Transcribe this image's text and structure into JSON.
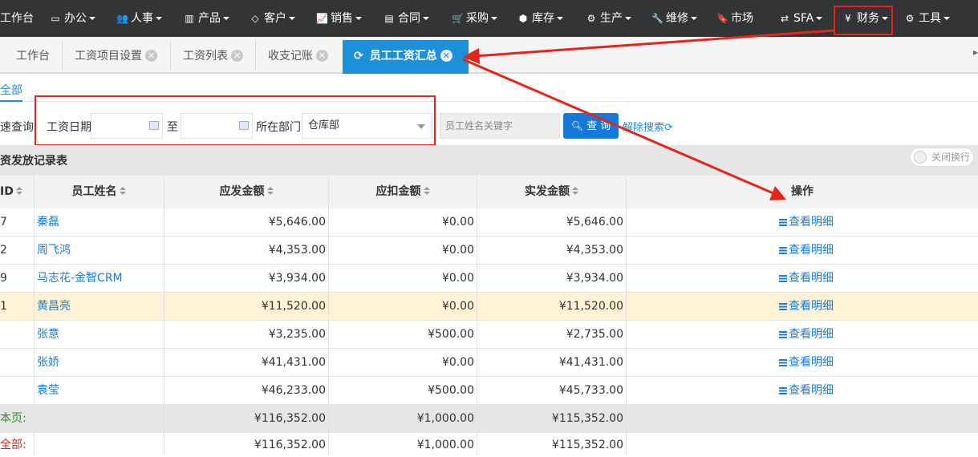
{
  "nav": {
    "items": [
      {
        "label": "工作台",
        "icon": "home-icon",
        "caret": false
      },
      {
        "label": "办公",
        "icon": "monitor-icon",
        "caret": true
      },
      {
        "label": "人事",
        "icon": "users-icon",
        "caret": true
      },
      {
        "label": "产品",
        "icon": "barcode-icon",
        "caret": true
      },
      {
        "label": "客户",
        "icon": "diamond-icon",
        "caret": true
      },
      {
        "label": "销售",
        "icon": "line-chart-icon",
        "caret": true
      },
      {
        "label": "合同",
        "icon": "newspaper-icon",
        "caret": true
      },
      {
        "label": "采购",
        "icon": "cart-icon",
        "caret": true
      },
      {
        "label": "库存",
        "icon": "cubes-icon",
        "caret": true
      },
      {
        "label": "生产",
        "icon": "gears-icon",
        "caret": true
      },
      {
        "label": "维修",
        "icon": "wrench-icon",
        "caret": true
      },
      {
        "label": "市场",
        "icon": "bookmark-icon",
        "caret": true
      },
      {
        "label": "SFA",
        "icon": "retweet-icon",
        "caret": true
      },
      {
        "label": "财务",
        "icon": "yen-icon",
        "caret": true
      },
      {
        "label": "工具",
        "icon": "cog-icon",
        "caret": true
      }
    ]
  },
  "tabs": [
    {
      "label": "工作台",
      "closable": false
    },
    {
      "label": "工资项目设置",
      "closable": true
    },
    {
      "label": "工资列表",
      "closable": true
    },
    {
      "label": "收支记账",
      "closable": true
    },
    {
      "label": "员工工资汇总",
      "closable": true,
      "active": true
    }
  ],
  "subtab": "全部",
  "search": {
    "quick_label": "速查询",
    "date_label": "工资日期",
    "to_label": "至",
    "dept_label": "所在部门",
    "dept_value": "仓库部",
    "keyword_placeholder": "员工姓名关键字",
    "query_button": "查 询",
    "clear_label": "解除搜索"
  },
  "section": {
    "title": "资发放记录表",
    "toggle_label": "关闭换行"
  },
  "table": {
    "columns": [
      "ID",
      "员工姓名",
      "应发金额",
      "应扣金额",
      "实发金额",
      "操作"
    ],
    "rows": [
      {
        "id": "7",
        "name": "秦磊",
        "gross": "¥5,646.00",
        "deduct": "¥0.00",
        "net": "¥5,646.00",
        "action": "查看明细",
        "highlight": false
      },
      {
        "id": "2",
        "name": "周飞鸿",
        "gross": "¥4,353.00",
        "deduct": "¥0.00",
        "net": "¥4,353.00",
        "action": "查看明细",
        "highlight": false
      },
      {
        "id": "9",
        "name": "马志花-金智CRM",
        "gross": "¥3,934.00",
        "deduct": "¥0.00",
        "net": "¥3,934.00",
        "action": "查看明细",
        "highlight": false
      },
      {
        "id": "1",
        "name": "黄昌亮",
        "gross": "¥11,520.00",
        "deduct": "¥0.00",
        "net": "¥11,520.00",
        "action": "查看明细",
        "highlight": true
      },
      {
        "id": "",
        "name": "张意",
        "gross": "¥3,235.00",
        "deduct": "¥500.00",
        "net": "¥2,735.00",
        "action": "查看明细",
        "highlight": false
      },
      {
        "id": "",
        "name": "张娇",
        "gross": "¥41,431.00",
        "deduct": "¥0.00",
        "net": "¥41,431.00",
        "action": "查看明细",
        "highlight": false
      },
      {
        "id": "",
        "name": "袁莹",
        "gross": "¥46,233.00",
        "deduct": "¥500.00",
        "net": "¥45,733.00",
        "action": "查看明细",
        "highlight": false
      }
    ],
    "page_total": {
      "label": "本页:",
      "gross": "¥116,352.00",
      "deduct": "¥1,000.00",
      "net": "¥115,352.00"
    },
    "all_total": {
      "label": "全部:",
      "gross": "¥116,352.00",
      "deduct": "¥1,000.00",
      "net": "¥115,352.00"
    }
  },
  "colors": {
    "nav_bg": "#333436",
    "active_tab": "#1e8fd9",
    "link": "#1e7bd0",
    "highlight_row": "#fef3d4",
    "annotation_red": "#e8231b",
    "page_total_label": "#2e8b2e",
    "all_total_label": "#d9261c"
  }
}
